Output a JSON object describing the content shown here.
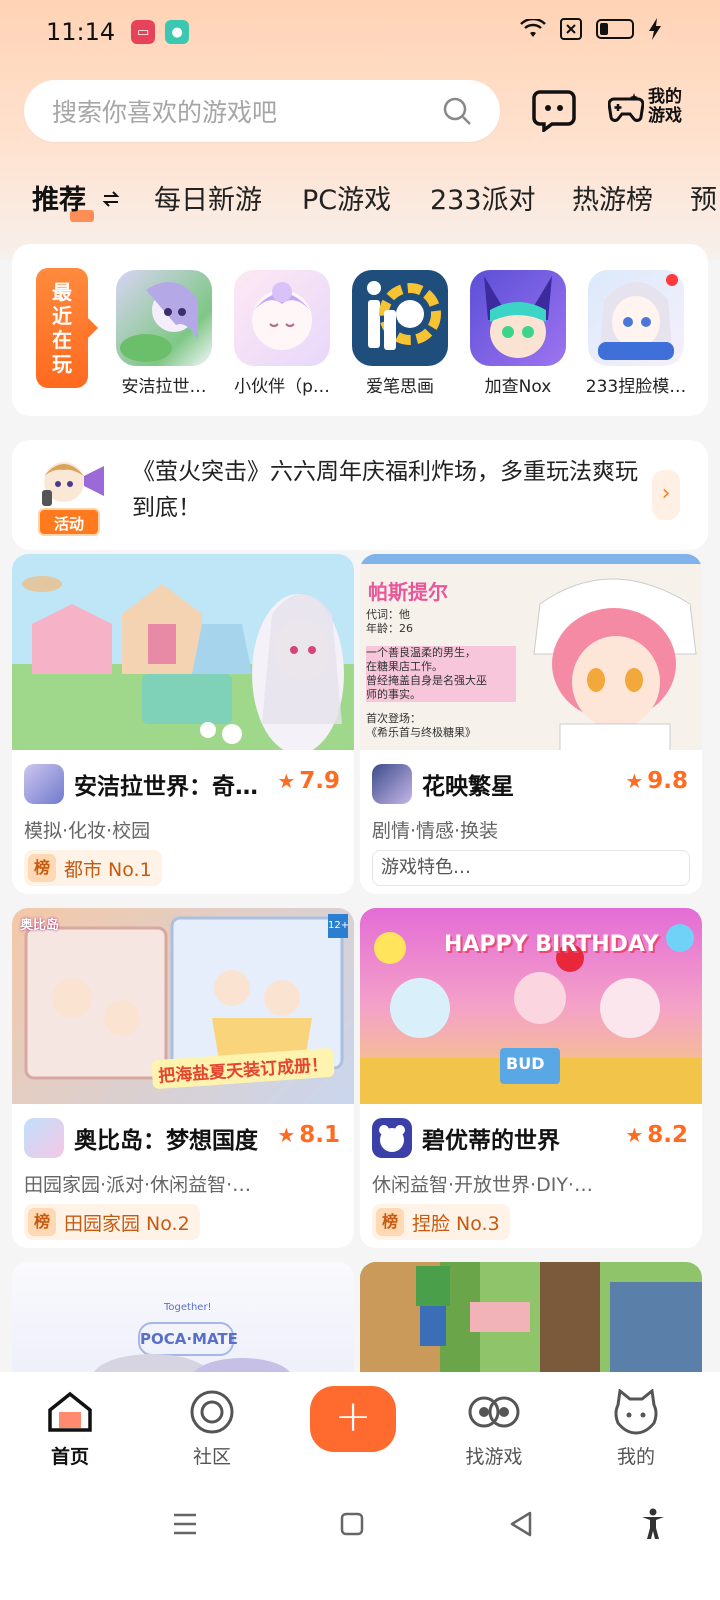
{
  "status_bar": {
    "time": "11:14"
  },
  "search": {
    "placeholder": "搜索你喜欢的游戏吧"
  },
  "header": {
    "my_games_line1": "我的",
    "my_games_line2": "游戏"
  },
  "tabs": [
    "推荐",
    "每日新游",
    "PC游戏",
    "233派对",
    "热游榜",
    "预"
  ],
  "recent": {
    "tag_chars": [
      "最",
      "近",
      "在",
      "玩"
    ],
    "items": [
      {
        "label": "安洁拉世…",
        "icon": "angela-world-icon"
      },
      {
        "label": "小伙伴（p…",
        "icon": "partner-icon"
      },
      {
        "label": "爱笔思画",
        "icon": "ibispaint-icon"
      },
      {
        "label": "加查Nox",
        "icon": "gacha-nox-icon"
      },
      {
        "label": "233捏脸模…",
        "icon": "face-maker-icon"
      }
    ]
  },
  "banner": {
    "badge": "活动",
    "text": "《萤火突击》六六周年庆福利炸场，多重玩法爽玩到底！",
    "arrow": "›"
  },
  "cards": [
    {
      "name": "安洁拉世界：奇…",
      "rating": "7.9",
      "tags": "模拟·化妆·校园",
      "rank_badge": "榜",
      "rank": "都市 No.1"
    },
    {
      "name": "花映繁星",
      "rating": "9.8",
      "tags": "剧情·情感·换装",
      "feature": "游戏特色…",
      "art_title": "帕斯提尔",
      "art_lines": [
        "代词：他",
        "年龄：26",
        "一个善良温柔的男生，",
        "在糖果店工作。",
        "曾经掩盖自身是名强大巫",
        "师的事实。",
        "首次登场：",
        "《希乐首与终极糖果》"
      ]
    },
    {
      "name": "奥比岛：梦想国度",
      "rating": "8.1",
      "tags": "田园家园·派对·休闲益智·…",
      "rank_badge": "榜",
      "rank": "田园家园 No.2",
      "art_caption": "把海盐夏天装订成册！",
      "art_sub": "奥比岛",
      "art_age": "12+"
    },
    {
      "name": "碧优蒂的世界",
      "rating": "8.2",
      "tags": "休闲益智·开放世界·DIY·…",
      "rank_badge": "榜",
      "rank": "捏脸 No.3",
      "art_caption": "HAPPY BIRTHDAY",
      "art_sub": "BUD"
    },
    {
      "name": "",
      "art_caption": "POCA·MATE",
      "art_sub": "Together!"
    },
    {
      "name": ""
    }
  ],
  "bottom_nav": [
    {
      "label": "首页",
      "icon": "home-icon"
    },
    {
      "label": "社区",
      "icon": "community-icon"
    },
    {
      "label": "",
      "icon": "plus-icon"
    },
    {
      "label": "找游戏",
      "icon": "find-game-icon"
    },
    {
      "label": "我的",
      "icon": "profile-icon"
    }
  ],
  "colors": {
    "accent": "#ff6b2e",
    "rating": "#ff6b1f",
    "rank_text": "#c85a10"
  }
}
